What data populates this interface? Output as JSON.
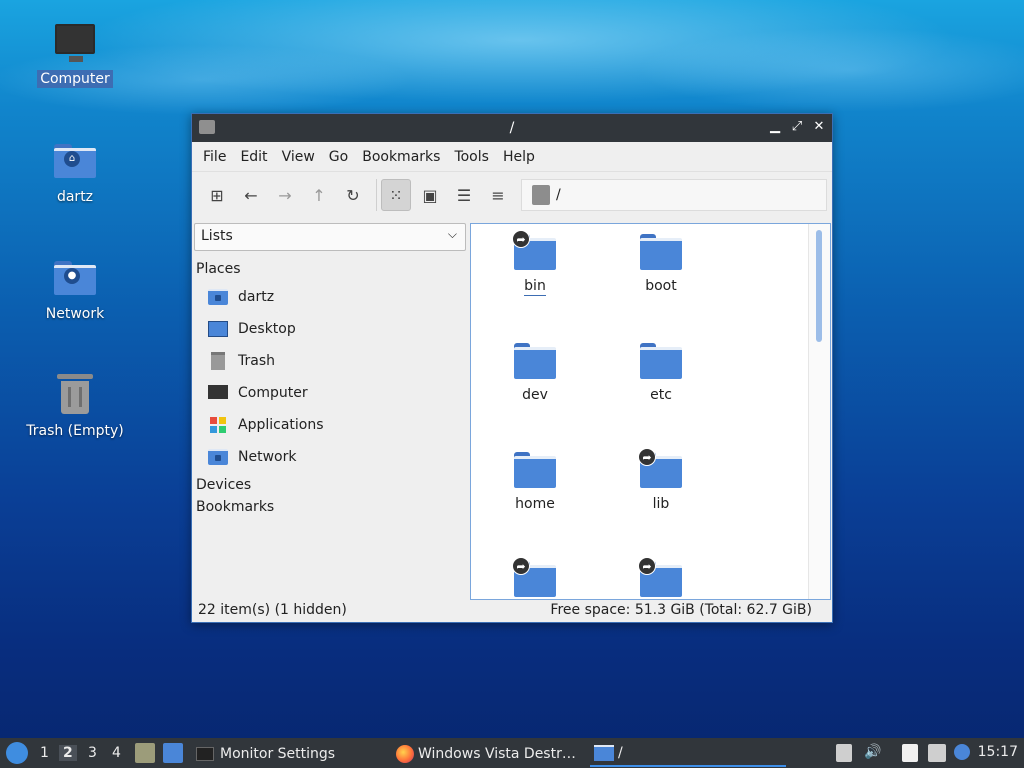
{
  "desktop": {
    "icons": [
      {
        "label": "Computer",
        "selected": true
      },
      {
        "label": "dartz"
      },
      {
        "label": "Network"
      },
      {
        "label": "Trash (Empty)"
      }
    ]
  },
  "window": {
    "title": "/",
    "menu": [
      "File",
      "Edit",
      "View",
      "Go",
      "Bookmarks",
      "Tools",
      "Help"
    ],
    "path": "/",
    "side_pane_mode": "Lists",
    "sidebar": {
      "places_header": "Places",
      "places": [
        "dartz",
        "Desktop",
        "Trash",
        "Computer",
        "Applications",
        "Network"
      ],
      "devices_header": "Devices",
      "bookmarks_header": "Bookmarks"
    },
    "files": [
      {
        "name": "bin",
        "link": true
      },
      {
        "name": "boot",
        "link": false
      },
      {
        "name": "dev",
        "link": false
      },
      {
        "name": "etc",
        "link": false
      },
      {
        "name": "home",
        "link": false
      },
      {
        "name": "lib",
        "link": true
      },
      {
        "name": "",
        "link": true
      },
      {
        "name": "",
        "link": true
      }
    ],
    "status_left": "22 item(s) (1 hidden)",
    "status_right": "Free space: 51.3 GiB (Total: 62.7 GiB)"
  },
  "taskbar": {
    "desktops": [
      "1",
      "2",
      "3",
      "4"
    ],
    "current_desktop": "2",
    "tasks": [
      "Monitor Settings",
      "Windows Vista Destr…",
      "/"
    ],
    "clock": "15:17"
  },
  "colors": {
    "accent": "#3d8ee8",
    "folder": "#4a86d8",
    "titlebar": "#31363b"
  }
}
